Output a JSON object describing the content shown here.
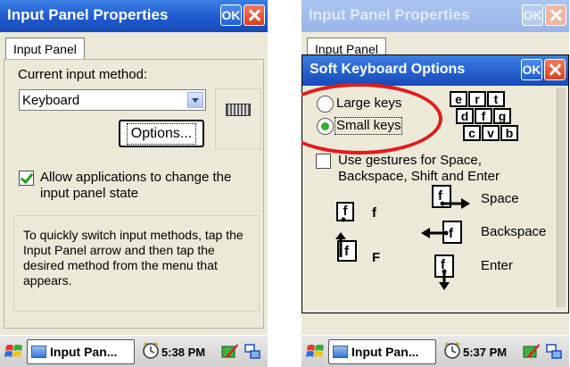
{
  "left_screen": {
    "title": "Input Panel Properties",
    "ok_label": "OK",
    "tab_label": "Input Panel",
    "current_method_label": "Current input method:",
    "method_value": "Keyboard",
    "options_button": "Options...",
    "allow_apps_label": "Allow applications to change the input panel state",
    "allow_apps_checked": true,
    "info_text": "To quickly switch input methods, tap the Input Panel arrow and then tap the desired method from the menu that appears.",
    "taskbar": {
      "task_label": "Input Pan...",
      "time": "5:38 PM"
    }
  },
  "right_screen": {
    "title": "Input Panel Properties",
    "ok_label": "OK",
    "tab_label": "Input Panel",
    "dialog": {
      "title": "Soft Keyboard Options",
      "ok_label": "OK",
      "large_keys_label": "Large keys",
      "small_keys_label": "Small keys",
      "selected_option": "Small keys",
      "key_preview": [
        "e",
        "r",
        "t",
        "d",
        "f",
        "g",
        "c",
        "v",
        "b"
      ],
      "gestures_label": "Use gestures for Space, Backspace, Shift and Enter",
      "gestures_checked": false,
      "gesture_f_label": "f",
      "gesture_F_label": "F",
      "space_label": "Space",
      "backspace_label": "Backspace",
      "enter_label": "Enter"
    },
    "taskbar": {
      "task_label": "Input Pan...",
      "time": "5:37 PM"
    }
  },
  "colors": {
    "titlebar": "#1f5bcf",
    "highlight_circle": "#e11b1b",
    "check_green": "#21a121"
  }
}
